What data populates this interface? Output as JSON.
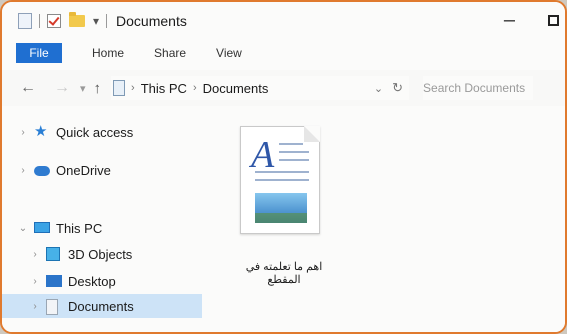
{
  "window": {
    "title": "Documents",
    "minimize_glyph": "–"
  },
  "ribbon": {
    "tabs": [
      "File",
      "Home",
      "Share",
      "View"
    ]
  },
  "address": {
    "breadcrumb": [
      "This PC",
      "Documents"
    ]
  },
  "search": {
    "placeholder": "Search Documents"
  },
  "nav_pane": {
    "items": [
      {
        "label": "Quick access",
        "icon": "star-icon"
      },
      {
        "label": "OneDrive",
        "icon": "cloud-icon"
      },
      {
        "label": "This PC",
        "icon": "monitor-icon",
        "expanded": true
      },
      {
        "label": "3D Objects",
        "icon": "cube-icon"
      },
      {
        "label": "Desktop",
        "icon": "desktop-icon"
      },
      {
        "label": "Documents",
        "icon": "documents-icon",
        "selected": true
      }
    ]
  },
  "files": [
    {
      "name": "اهم ما تعلمته في المقطع",
      "icon": "document-icon"
    }
  ],
  "colors": {
    "accent": "#1f6fd1",
    "selected": "#cde3f7",
    "frame": "#e07a2e"
  }
}
